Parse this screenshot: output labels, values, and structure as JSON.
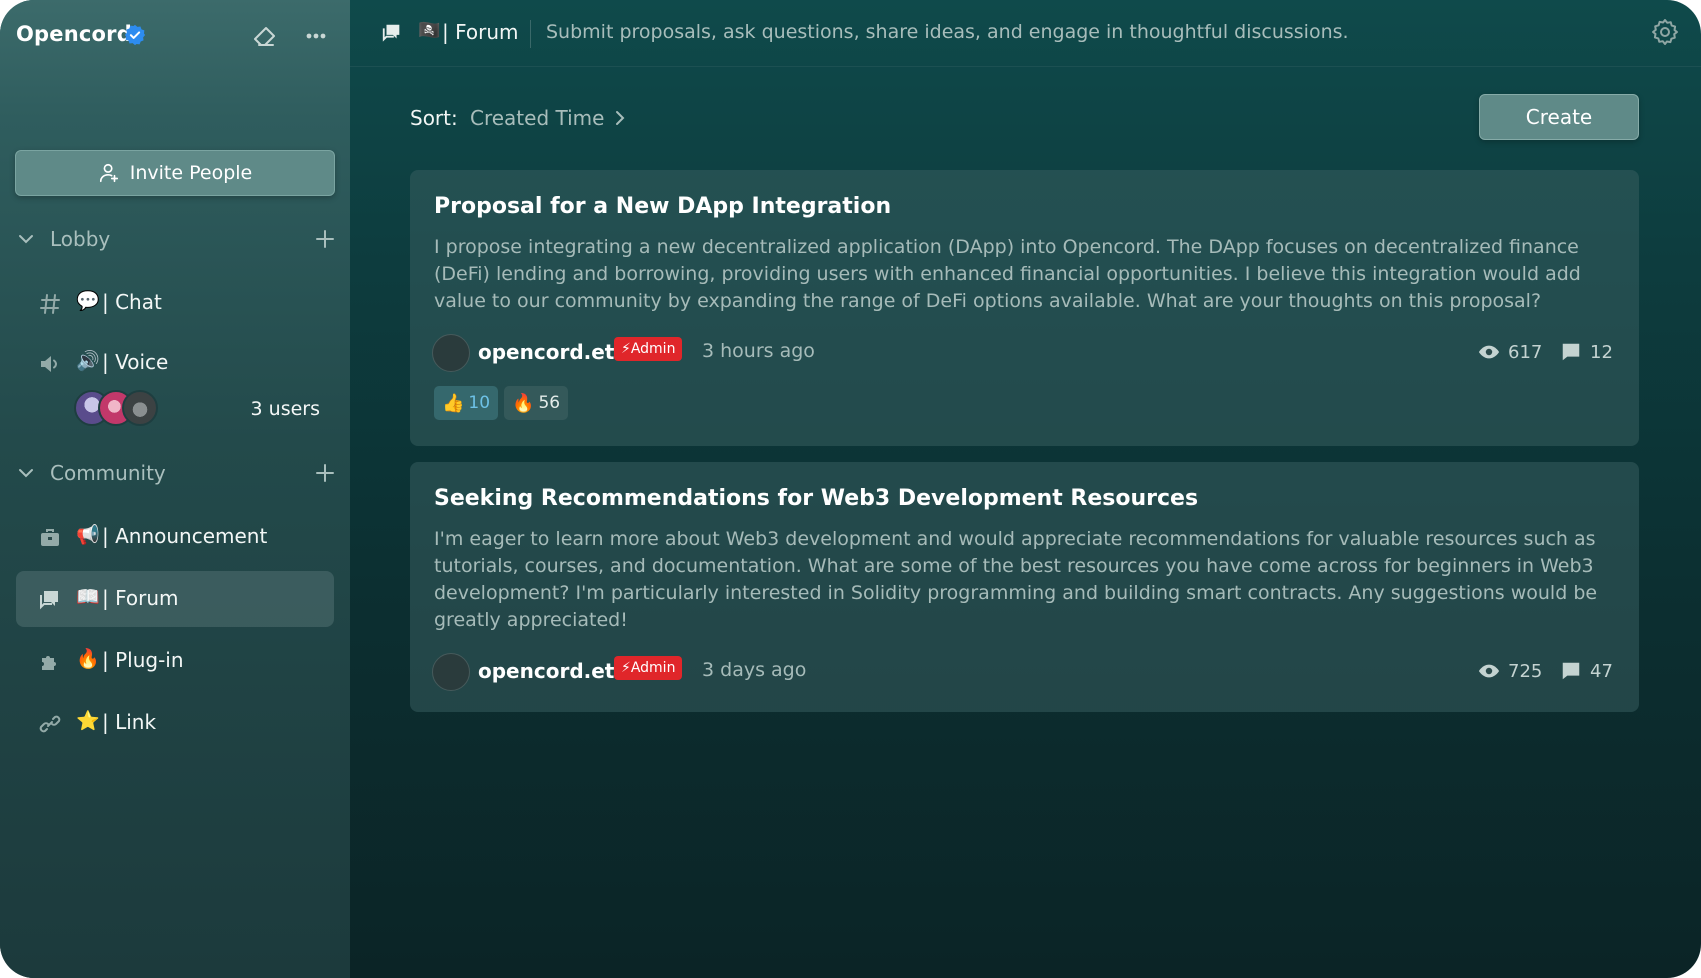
{
  "server": {
    "name": "Opencord"
  },
  "sidebar": {
    "invite_label": "Invite People",
    "groups": [
      {
        "name": "Lobby"
      },
      {
        "name": "Community"
      }
    ],
    "channels": [
      {
        "emoji": "💬",
        "label": "| Chat",
        "icon": "hash-icon"
      },
      {
        "emoji": "🔊",
        "label": "| Voice",
        "icon": "speaker-icon"
      },
      {
        "emoji": "📢",
        "label": "| Announcement",
        "icon": "briefcase-icon"
      },
      {
        "emoji": "📖",
        "label": "| Forum",
        "icon": "forum-icon"
      },
      {
        "emoji": "🔥",
        "label": "| Plug-in",
        "icon": "puzzle-icon"
      },
      {
        "emoji": "⭐",
        "label": "| Link",
        "icon": "link-icon"
      }
    ],
    "voice_users_label": "3 users"
  },
  "topbar": {
    "flag": "🏴‍☠️",
    "title": "| Forum",
    "description": "Submit proposals, ask questions, share ideas, and engage in thoughtful discussions."
  },
  "sort": {
    "label": "Sort:",
    "value": "Created Time"
  },
  "create_label": "Create",
  "posts": [
    {
      "title": "Proposal for a New DApp Integration",
      "body": "I propose integrating a new decentralized application (DApp) into Opencord. The DApp focuses on decentralized finance (DeFi) lending and borrowing, providing users with enhanced financial opportunities. I believe this integration would add value to our community by expanding the range of DeFi options available. What are your thoughts on this proposal?",
      "author": "opencord.eth",
      "badge": "⚡Admin",
      "time": "3 hours ago",
      "views": "617",
      "comments": "12",
      "reactions": [
        {
          "emoji": "👍",
          "count": "10"
        },
        {
          "emoji": "🔥",
          "count": "56"
        }
      ]
    },
    {
      "title": "Seeking Recommendations for Web3 Development Resources",
      "body": "I'm eager to learn more about Web3 development and would appreciate recommendations for valuable resources such as tutorials, courses, and documentation. What are some of the best resources you have come across for beginners in Web3 development? I'm particularly interested in Solidity programming and building smart contracts. Any suggestions would be greatly appreciated!",
      "author": "opencord.eth",
      "badge": "⚡Admin",
      "time": "3 days ago",
      "views": "725",
      "comments": "47"
    }
  ],
  "colors": {
    "accent": "#5f8a88",
    "admin_badge": "#e0262a",
    "reaction_active": "#6dc1e6"
  }
}
